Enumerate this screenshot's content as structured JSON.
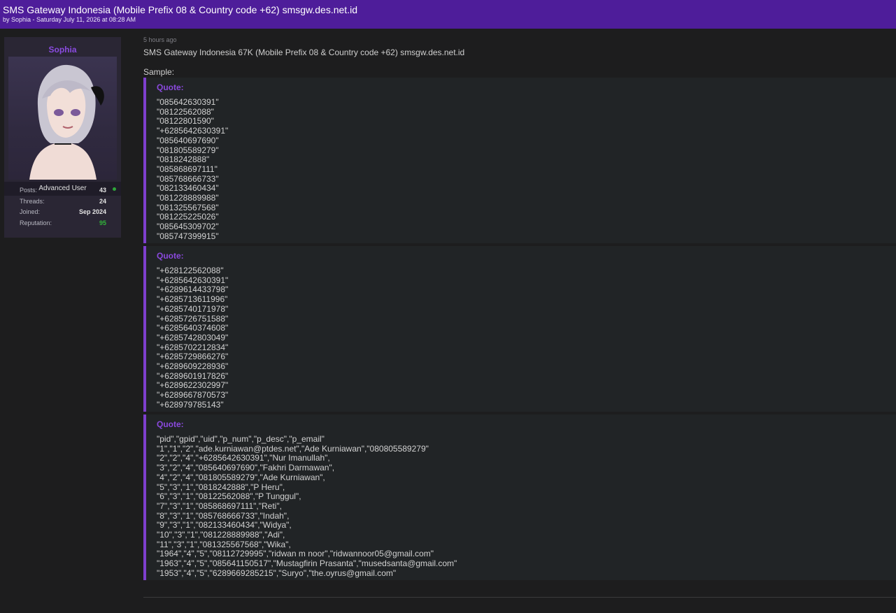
{
  "thread": {
    "title": "SMS Gateway Indonesia (Mobile Prefix 08 & Country code +62) smsgw.des.net.id",
    "byline": "by Sophia - Saturday July 11, 2026 at 08:28 AM"
  },
  "user": {
    "name": "Sophia",
    "rank": "Advanced User",
    "stats": [
      {
        "label": "Posts:",
        "value": "43"
      },
      {
        "label": "Threads:",
        "value": "24"
      },
      {
        "label": "Joined:",
        "value": "Sep 2024"
      },
      {
        "label": "Reputation:",
        "value": "95"
      }
    ],
    "colors": {
      "name": "#8a4be0",
      "online": "#2fa63a",
      "reputation": "#31b43a"
    }
  },
  "post": {
    "time": "5 hours ago",
    "headline": "SMS Gateway Indonesia 67K (Mobile Prefix 08 & Country code +62) smsgw.des.net.id",
    "sample_label": "Sample:",
    "quotes": [
      {
        "label": "Quote:",
        "lines": [
          "\"085642630391\"",
          "\"08122562088\"",
          "\"08122801590\"",
          "\"+6285642630391\"",
          "\"085640697690\"",
          "\"081805589279\"",
          "\"0818242888\"",
          "\"085868697111\"",
          "\"085768666733\"",
          "\"082133460434\"",
          "\"081228889988\"",
          "\"081325567568\"",
          "\"081225225026\"",
          "\"085645309702\"",
          "\"085747399915\""
        ]
      },
      {
        "label": "Quote:",
        "lines": [
          "\"+628122562088\"",
          "\"+6285642630391\"",
          "\"+6289614433798\"",
          "\"+6285713611996\"",
          "\"+6285740171978\"",
          "\"+6285726751588\"",
          "\"+6285640374608\"",
          "\"+6285742803049\"",
          "\"+6285702212834\"",
          "\"+6285729866276\"",
          "\"+6289609228936\"",
          "\"+6289601917826\"",
          "\"+6289622302997\"",
          "\"+6289667870573\"",
          "\"+628979785143\""
        ]
      },
      {
        "label": "Quote:",
        "lines": [
          "\"pid\",\"gpid\",\"uid\",\"p_num\",\"p_desc\",\"p_email\"",
          "\"1\",\"1\",\"2\",\"ade.kurniawan@ptdes.net\",\"Ade Kurniawan\",\"080805589279\"",
          "\"2\",\"2\",\"4\",\"+6285642630391\",\"Nur Imanullah\",",
          "\"3\",\"2\",\"4\",\"085640697690\",\"Fakhri Darmawan\",",
          "\"4\",\"2\",\"4\",\"081805589279\",\"Ade Kurniawan\",",
          "\"5\",\"3\",\"1\",\"0818242888\",\"P Heru\",",
          "\"6\",\"3\",\"1\",\"08122562088\",\"P Tunggul\",",
          "\"7\",\"3\",\"1\",\"085868697111\",\"Reti\",",
          "\"8\",\"3\",\"1\",\"085768666733\",\"Indah\",",
          "\"9\",\"3\",\"1\",\"082133460434\",\"Widya\",",
          "\"10\",\"3\",\"1\",\"081228889988\",\"Adi\",",
          "\"11\",\"3\",\"1\",\"081325567568\",\"Wika\",",
          "\"1964\",\"4\",\"5\",\"08112729995\",\"ridwan m noor\",\"ridwannoor05@gmail.com\"",
          "\"1963\",\"4\",\"5\",\"085641150517\",\"Mustagfirin Prasanta\",\"musedsanta@gmail.com\"",
          "\"1953\",\"4\",\"5\",\"6289669285215\",\"Suryo\",\"the.oyrus@gmail.com\""
        ]
      }
    ],
    "colors": {
      "accent": "#7e3fce",
      "quote_label": "#8a49dd",
      "header_bg": "#4e1d9a"
    }
  },
  "icons": {
    "online": "online-status-dot",
    "avatar": "avatar-image"
  }
}
